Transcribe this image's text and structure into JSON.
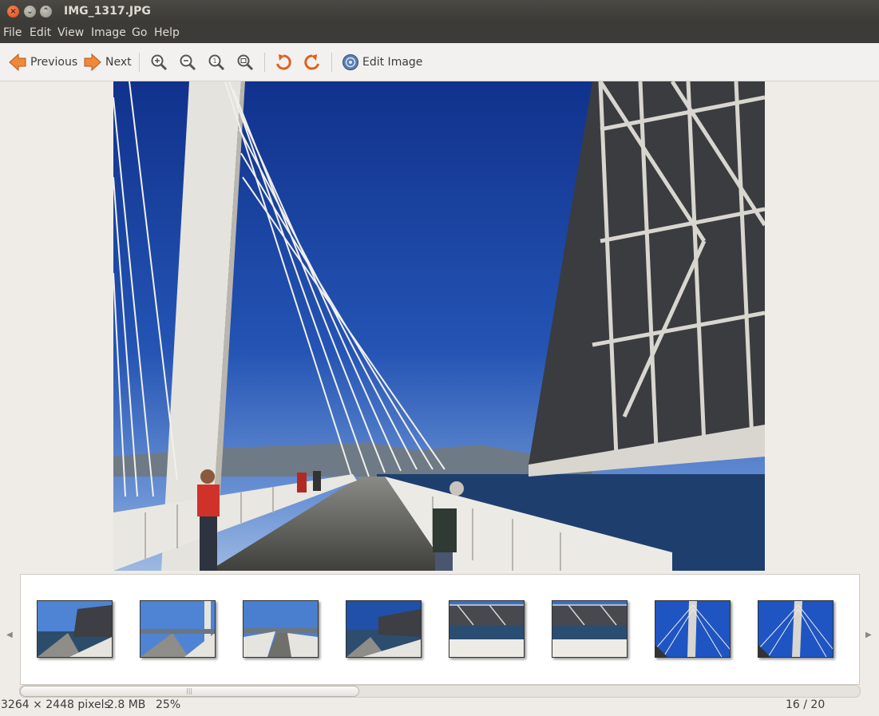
{
  "window": {
    "title": "IMG_1317.JPG"
  },
  "menu": [
    "File",
    "Edit",
    "View",
    "Image",
    "Go",
    "Help"
  ],
  "toolbar": {
    "previous_label": "Previous",
    "next_label": "Next",
    "edit_image_label": "Edit Image",
    "icons": [
      "go-previous-icon",
      "go-next-icon",
      "zoom-in-icon",
      "zoom-out-icon",
      "zoom-normal-icon",
      "zoom-fit-icon",
      "rotate-left-icon",
      "rotate-right-icon",
      "edit-image-icon"
    ]
  },
  "colors": {
    "sky": "#1f3f99",
    "sky_light": "#3d6cc9",
    "accent": "#e8762b",
    "titlebar": "#3c3b37"
  },
  "status": {
    "dimensions": "3264 × 2448 pixels",
    "file_size": "2.8 MB",
    "zoom": "25%",
    "position": "16 / 20"
  },
  "thumbnails": {
    "scroll_fraction": 0.4
  }
}
